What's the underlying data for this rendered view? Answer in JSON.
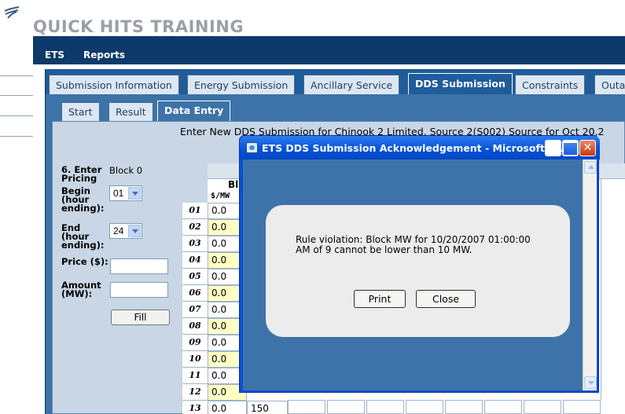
{
  "brand": {
    "title": "QUICK HITS TRAINING"
  },
  "topnav": {
    "items": [
      "ETS",
      "Reports"
    ]
  },
  "main_tabs": [
    {
      "label": "Submission Information",
      "active": false
    },
    {
      "label": "Energy Submission",
      "active": false
    },
    {
      "label": "Ancillary Service",
      "active": false
    },
    {
      "label": "DDS Submission",
      "active": true
    },
    {
      "label": "Constraints",
      "active": false
    },
    {
      "label": "Outa",
      "active": false
    }
  ],
  "sub_tabs": [
    {
      "label": "Start",
      "active": false
    },
    {
      "label": "Result",
      "active": false
    },
    {
      "label": "Data Entry",
      "active": true
    }
  ],
  "page_heading": "Enter New DDS Submission for Chinook 2 Limited, Source 2(S002) Source for Oct 20,2",
  "form": {
    "step_label": "6. Enter Pricing",
    "block_value": "Block 0",
    "begin_label": "Begin (hour ending):",
    "begin_value": "01",
    "end_label": "End (hour ending):",
    "end_value": "24",
    "price_label": "Price ($):",
    "amount_label": "Amount (MW):",
    "fill_label": "Fill"
  },
  "grid": {
    "block_header": "Bl",
    "unit_header": "$/MW",
    "unit_header_right": "$/",
    "rows": [
      {
        "hour": "01",
        "price": "0.0"
      },
      {
        "hour": "02",
        "price": "0.0"
      },
      {
        "hour": "03",
        "price": "0.0"
      },
      {
        "hour": "04",
        "price": "0.0"
      },
      {
        "hour": "05",
        "price": "0.0"
      },
      {
        "hour": "06",
        "price": "0.0"
      },
      {
        "hour": "07",
        "price": "0.0"
      },
      {
        "hour": "08",
        "price": "0.0"
      },
      {
        "hour": "09",
        "price": "0.0"
      },
      {
        "hour": "10",
        "price": "0.0"
      },
      {
        "hour": "11",
        "price": "0.0"
      },
      {
        "hour": "12",
        "price": "0.0"
      },
      {
        "hour": "13",
        "price": "0.0",
        "mw": "150"
      }
    ]
  },
  "dialog": {
    "title": "ETS DDS Submission Acknowledgement - Microsoft I...",
    "message": "Rule violation: Block MW for 10/20/2007 01:00:00 AM of 9 cannot be lower than 10 MW.",
    "print_label": "Print",
    "close_label": "Close"
  }
}
